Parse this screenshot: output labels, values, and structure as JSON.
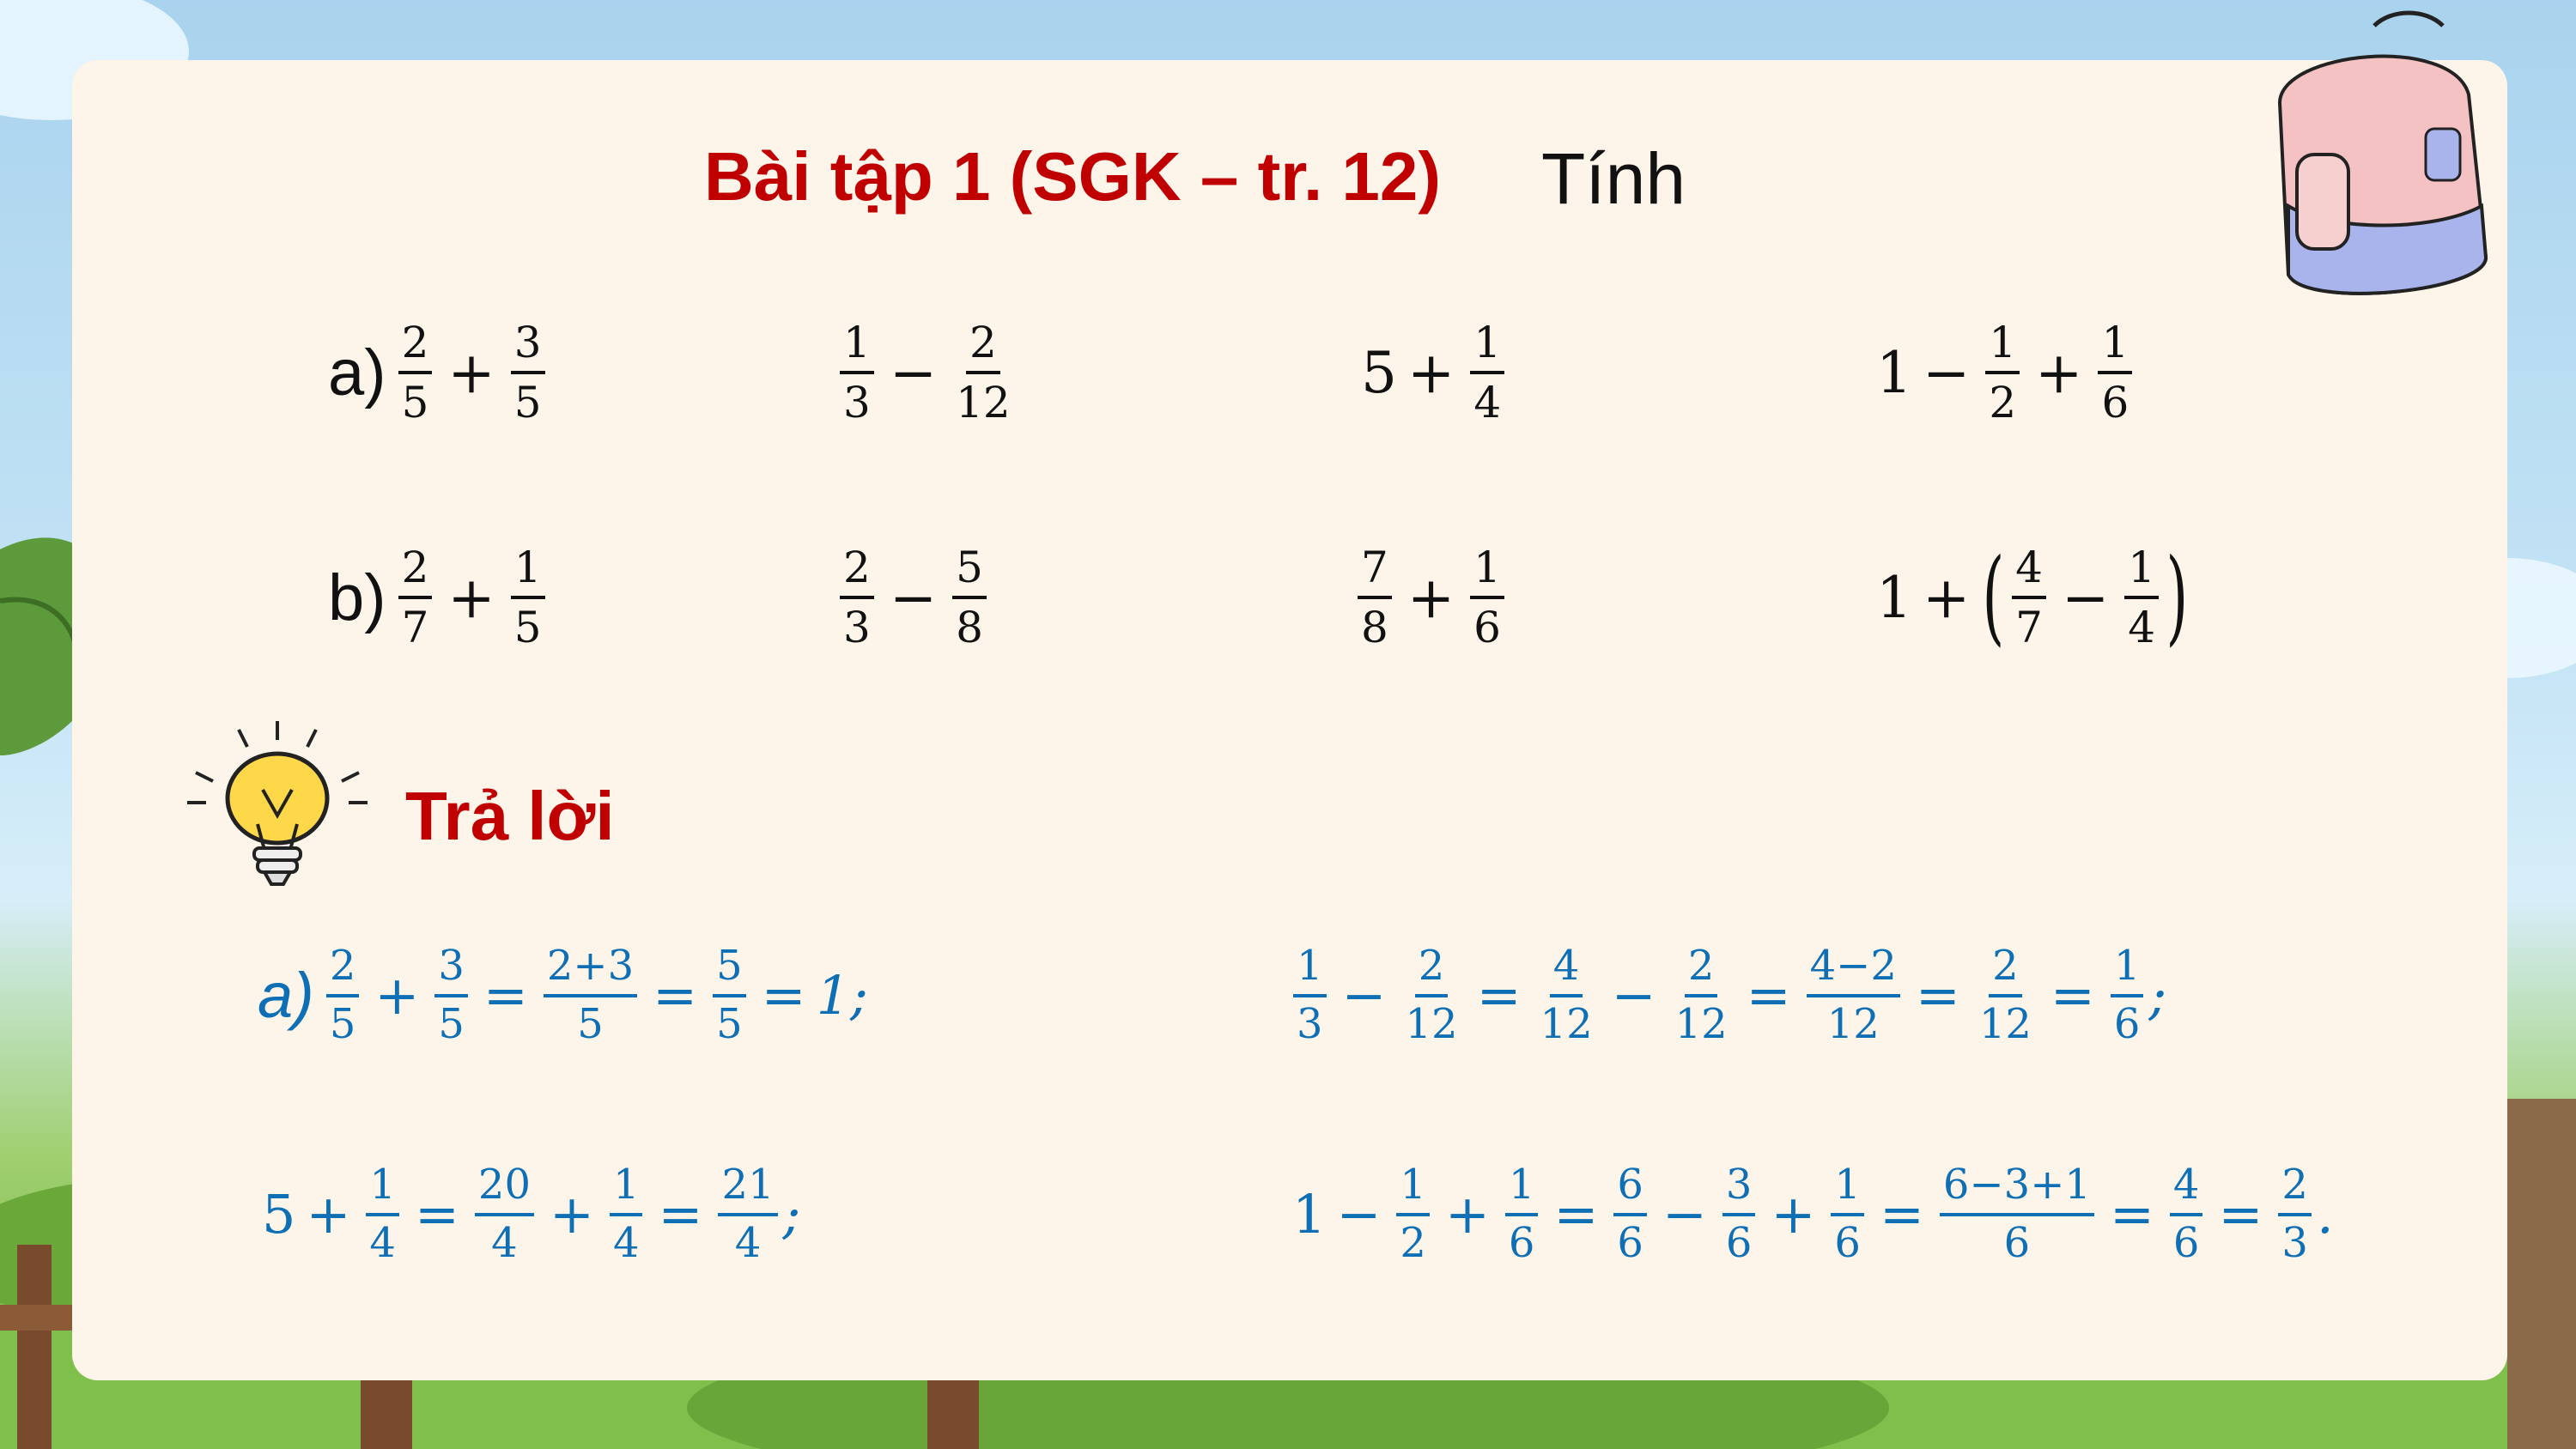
{
  "header": {
    "title": "Bài tập 1 (SGK – tr. 12)",
    "subtitle": "Tính"
  },
  "exercises": {
    "a": {
      "label": "a)",
      "items": [
        [
          "2",
          "5",
          "+",
          "3",
          "5"
        ],
        [
          "1",
          "3",
          "−",
          "2",
          "12"
        ],
        [
          "5",
          "+",
          "1",
          "4"
        ],
        [
          "1",
          "−",
          "1",
          "2",
          "+",
          "1",
          "6"
        ]
      ]
    },
    "b": {
      "label": "b)",
      "items": [
        [
          "2",
          "7",
          "+",
          "1",
          "5"
        ],
        [
          "2",
          "3",
          "−",
          "5",
          "8"
        ],
        [
          "7",
          "8",
          "+",
          "1",
          "6"
        ],
        [
          "1",
          "+",
          "(",
          "4",
          "7",
          "−",
          "1",
          "4",
          ")"
        ]
      ]
    }
  },
  "answer": {
    "heading": "Trả lời",
    "label": "a)",
    "a1": [
      "2",
      "5",
      "+",
      "3",
      "5",
      "=",
      "2+3",
      "5",
      "=",
      "5",
      "5",
      "=",
      "1;"
    ],
    "a2": [
      "1",
      "3",
      "−",
      "2",
      "12",
      "=",
      "4",
      "12",
      "−",
      "2",
      "12",
      "=",
      "4−2",
      "12",
      "=",
      "2",
      "12",
      "=",
      "1",
      "6",
      ";"
    ],
    "a3": [
      "5",
      "+",
      "1",
      "4",
      "=",
      "20",
      "4",
      "+",
      "1",
      "4",
      "=",
      "21",
      "4",
      ";"
    ],
    "a4": [
      "1",
      "−",
      "1",
      "2",
      "+",
      "1",
      "6",
      "=",
      "6",
      "6",
      "−",
      "3",
      "6",
      "+",
      "1",
      "6",
      "=",
      "6−3+1",
      "6",
      "=",
      "4",
      "6",
      "=",
      "2",
      "3",
      "."
    ]
  },
  "colors": {
    "title_red": "#c00000",
    "answer_blue": "#0f6fb5",
    "card": "#fdf4ea"
  }
}
